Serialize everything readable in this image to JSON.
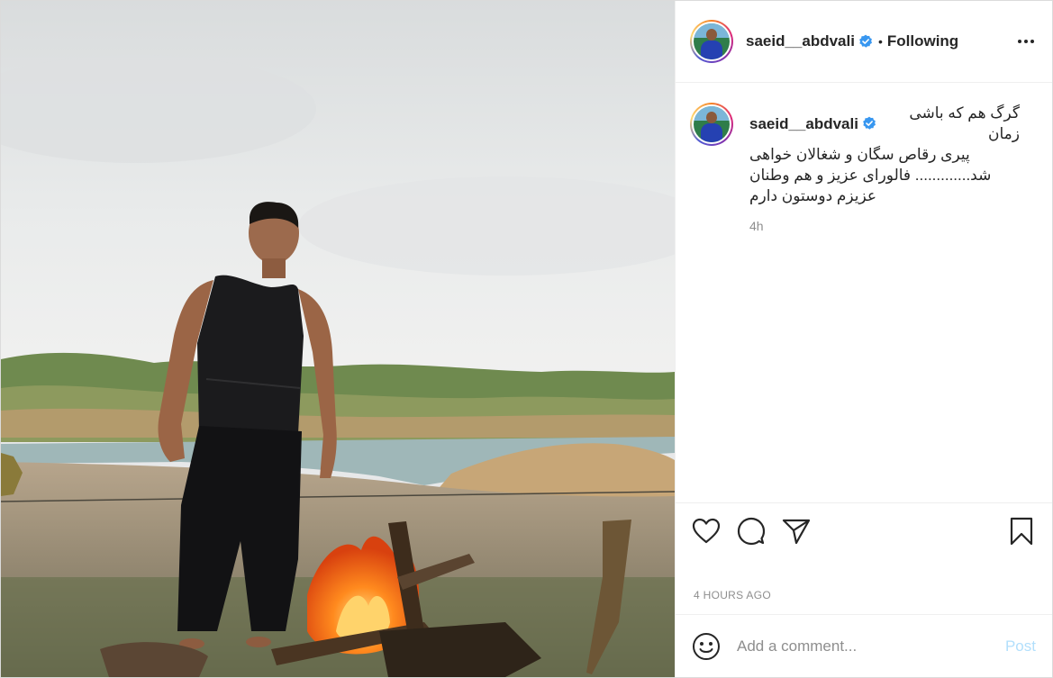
{
  "post": {
    "author": "saeid__abdvali",
    "follow_state": "Following",
    "separator": "•",
    "caption_lines": [
      "گرگ هم که باشی زمان",
      "پیری رقاص سگان و شغالان خواهی",
      "شد............. فالورای عزیز و هم وطنان",
      "عزیزم دوستون دارم"
    ],
    "caption_age": "4h",
    "posted_ago": "4 HOURS AGO"
  },
  "icons": {
    "verified": "verified-badge-icon",
    "more": "more-options-icon",
    "like": "heart-icon",
    "comment": "comment-bubble-icon",
    "share": "paper-plane-icon",
    "save": "bookmark-icon",
    "emoji": "smiley-icon"
  },
  "composer": {
    "placeholder": "Add a comment...",
    "post_label": "Post"
  },
  "colors": {
    "verified_blue": "#3897f0",
    "post_disabled": "#b2dffc",
    "muted_text": "#8e8e8e"
  }
}
